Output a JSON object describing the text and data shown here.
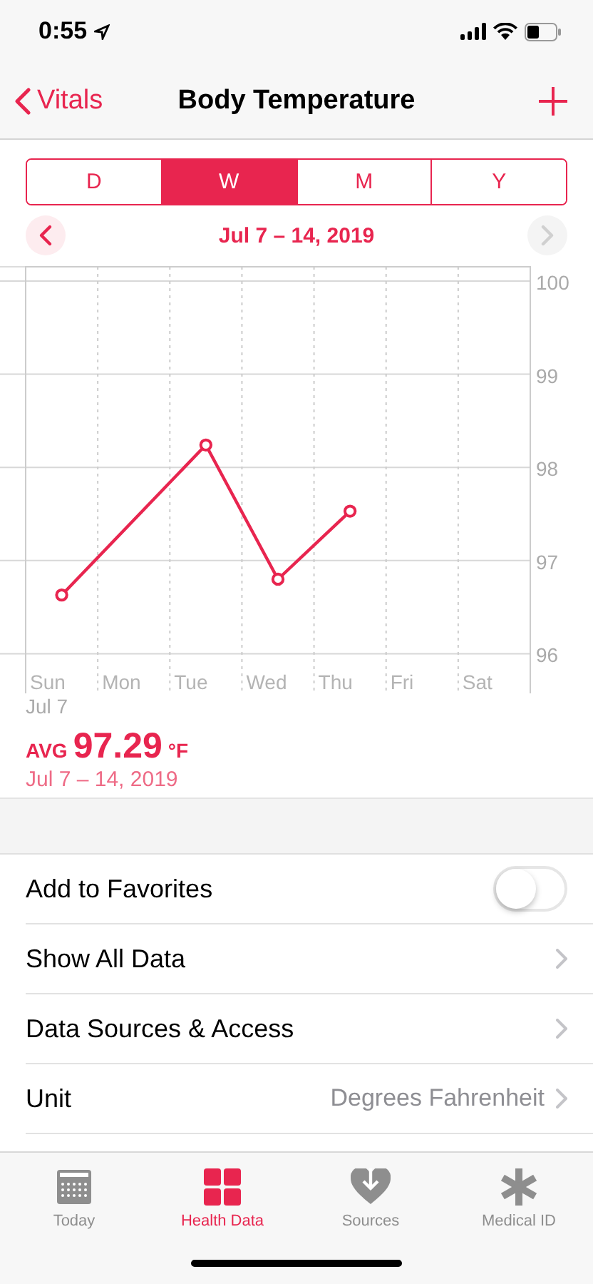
{
  "status_bar": {
    "time": "0:55"
  },
  "nav": {
    "back": "Vitals",
    "title": "Body Temperature"
  },
  "segments": [
    {
      "label": "D",
      "selected": false
    },
    {
      "label": "W",
      "selected": true
    },
    {
      "label": "M",
      "selected": false
    },
    {
      "label": "Y",
      "selected": false
    }
  ],
  "date_range": {
    "label": "Jul 7 – 14, 2019",
    "prev_disabled": false,
    "next_disabled": true
  },
  "chart_data": {
    "type": "line",
    "categories": [
      "Sun",
      "Mon",
      "Tue",
      "Wed",
      "Thu",
      "Fri",
      "Sat"
    ],
    "series": [
      {
        "color": "#e8254f",
        "marker": "o",
        "values": [
          96.63,
          null,
          98.24,
          96.8,
          97.53,
          null,
          null
        ]
      }
    ],
    "ylim": [
      96,
      100
    ],
    "yticks": [
      96,
      97,
      98,
      99,
      100
    ],
    "grid": true
  },
  "chart_start_label": "Jul 7",
  "average": {
    "prefix": "AVG",
    "value": "97.29",
    "unit": "°F",
    "range": "Jul 7 – 14, 2019"
  },
  "rows": [
    {
      "kind": "toggle",
      "label": "Add to Favorites",
      "on": false
    },
    {
      "kind": "link",
      "label": "Show All Data"
    },
    {
      "kind": "link",
      "label": "Data Sources & Access"
    },
    {
      "kind": "value",
      "label": "Unit",
      "value": "Degrees Fahrenheit"
    }
  ],
  "tab_bar": [
    {
      "label": "Today",
      "selected": false
    },
    {
      "label": "Health Data",
      "selected": true
    },
    {
      "label": "Sources",
      "selected": false
    },
    {
      "label": "Medical ID",
      "selected": false
    }
  ]
}
